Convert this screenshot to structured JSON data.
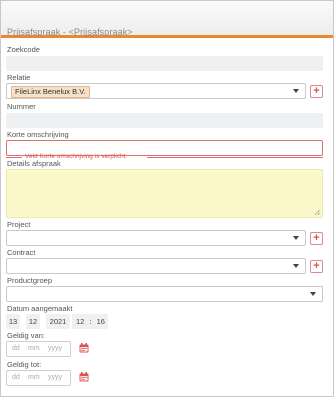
{
  "window": {
    "title": "Prijsafspraak - <Prijsafspraak>"
  },
  "fields": {
    "zoekcode": {
      "label": "Zoekcode",
      "value": ""
    },
    "relatie": {
      "label": "Relatie",
      "value": "FileLinx Benelux B.V."
    },
    "nummer": {
      "label": "Nummer",
      "value": ""
    },
    "korte_omschrijving": {
      "label": "Korte omschrijving",
      "value": "",
      "error": "Veld Korte omschrijving is verplicht."
    },
    "details_afspraak": {
      "label": "Details afspraak",
      "value": ""
    },
    "project": {
      "label": "Project",
      "value": ""
    },
    "contract": {
      "label": "Contract",
      "value": ""
    },
    "productgroep": {
      "label": "Productgroep",
      "value": ""
    },
    "datum_aangemaakt": {
      "label": "Datum aangemaakt",
      "day": "13",
      "month": "12",
      "year": "2021",
      "hour": "12",
      "sep": ":",
      "minute": "16"
    },
    "geldig_van": {
      "label": "Geldig van:",
      "dd": "dd",
      "mm": "mm",
      "yyyy": "yyyy"
    },
    "geldig_tot": {
      "label": "Geldig tot:",
      "dd": "dd",
      "mm": "mm",
      "yyyy": "yyyy"
    }
  },
  "buttons": {
    "add_symbol": "+"
  },
  "colors": {
    "accent": "#e8892e",
    "error": "#d9534f",
    "tag_bg": "#f6e0c8",
    "textarea_bg": "#fbf8c9"
  },
  "icons": {
    "dropdown": "chevron-down-icon",
    "add": "plus-icon",
    "calendar": "calendar-icon"
  }
}
